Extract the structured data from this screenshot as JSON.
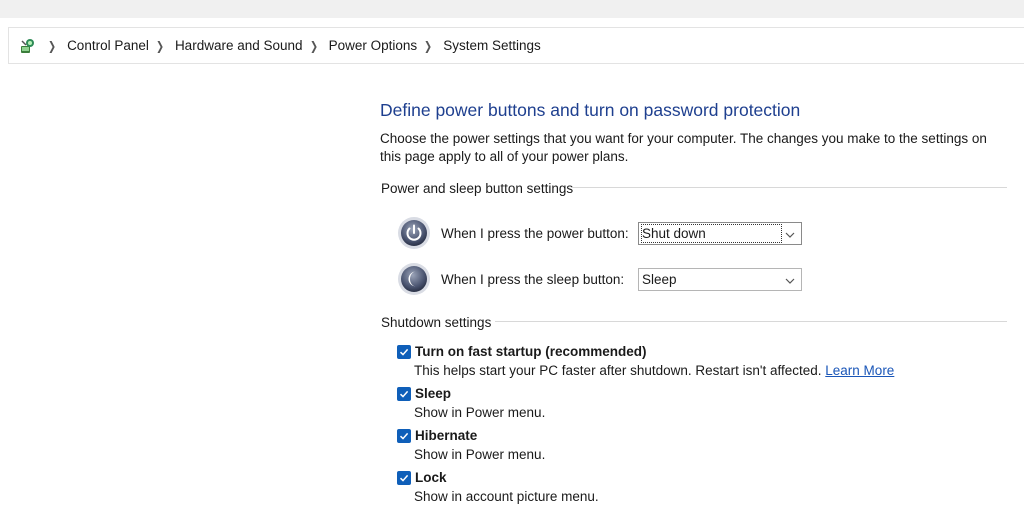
{
  "breadcrumb": {
    "items": [
      "Control Panel",
      "Hardware and Sound",
      "Power Options",
      "System Settings"
    ]
  },
  "page": {
    "title": "Define power buttons and turn on password protection",
    "description": "Choose the power settings that you want for your computer. The changes you make to the settings on this page apply to all of your power plans."
  },
  "power_group": {
    "header": "Power and sleep button settings",
    "power_button": {
      "label": "When I press the power button:",
      "value": "Shut down"
    },
    "sleep_button": {
      "label": "When I press the sleep button:",
      "value": "Sleep"
    }
  },
  "shutdown_group": {
    "header": "Shutdown settings",
    "fast_startup": {
      "label": "Turn on fast startup (recommended)",
      "checked": true,
      "description": "This helps start your PC faster after shutdown. Restart isn't affected.",
      "link": "Learn More"
    },
    "sleep": {
      "label": "Sleep",
      "checked": true,
      "description": "Show in Power menu."
    },
    "hibernate": {
      "label": "Hibernate",
      "checked": true,
      "description": "Show in Power menu."
    },
    "lock": {
      "label": "Lock",
      "checked": true,
      "description": "Show in account picture menu."
    }
  },
  "colors": {
    "title": "#1e3f8f",
    "checkbox": "#0f5fb9",
    "link": "#1a56b8"
  },
  "icons": {
    "control_panel": "control-panel-icon",
    "power": "power-icon",
    "sleep": "moon-icon",
    "checkmark": "checkmark-icon",
    "dropdown": "chevron-down-icon"
  }
}
